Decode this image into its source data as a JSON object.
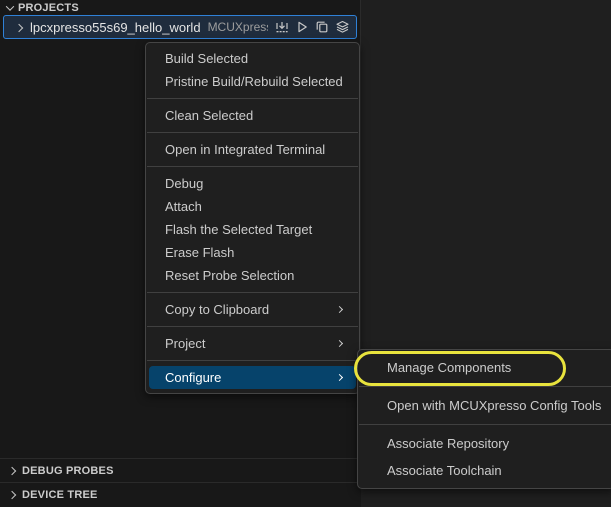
{
  "colors": {
    "editor_bg": "#1f1f1f",
    "sidebar_bg": "#181818",
    "menu_bg": "#1f1f1f",
    "menu_border": "#454545",
    "menu_text": "#cccccc",
    "menu_active_bg": "#06436b",
    "selection_bg": "#1f2c3d",
    "selection_border": "#2f81d7",
    "annotation_yellow": "#e8e33d"
  },
  "sidebar": {
    "projects_section": {
      "label": "PROJECTS"
    },
    "project_row": {
      "name": "lpcxpresso55s69_hello_world",
      "description": "MCUXpress...",
      "action_icons": [
        "install-build-icon",
        "debug-play-icon",
        "copy-icon",
        "layers-icon"
      ]
    },
    "debug_probes_section": {
      "label": "DEBUG PROBES"
    },
    "device_tree_section": {
      "label": "DEVICE TREE"
    }
  },
  "context_menu": {
    "items": [
      {
        "label": "Build Selected"
      },
      {
        "label": "Pristine Build/Rebuild Selected"
      },
      {
        "label": "Clean Selected"
      },
      {
        "label": "Open in Integrated Terminal"
      },
      {
        "label": "Debug"
      },
      {
        "label": "Attach"
      },
      {
        "label": "Flash the Selected Target"
      },
      {
        "label": "Erase Flash"
      },
      {
        "label": "Reset Probe Selection"
      },
      {
        "label": "Copy to Clipboard",
        "has_submenu": true
      },
      {
        "label": "Project",
        "has_submenu": true
      },
      {
        "label": "Configure",
        "has_submenu": true,
        "active": true
      }
    ]
  },
  "submenu": {
    "items": [
      {
        "label": "Manage Components",
        "annotated": true
      },
      {
        "label": "Open with MCUXpresso Config Tools"
      },
      {
        "label": "Associate Repository"
      },
      {
        "label": "Associate Toolchain"
      }
    ]
  },
  "annotation": {
    "shape": "ellipse",
    "color": "#e8e33d",
    "target": "Manage Components"
  }
}
